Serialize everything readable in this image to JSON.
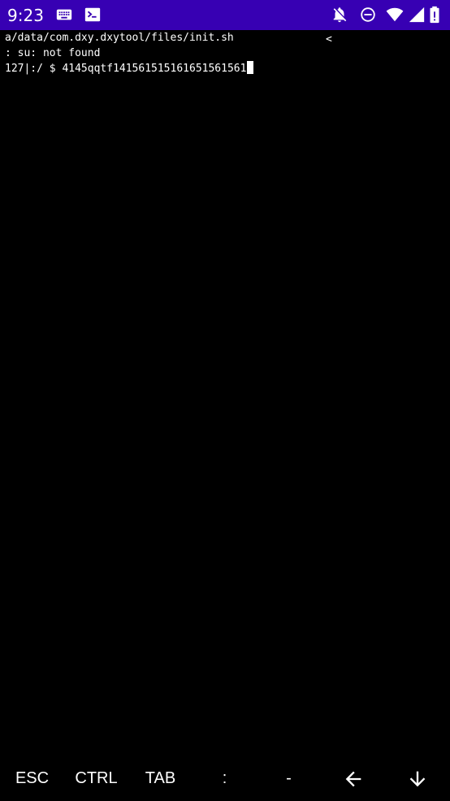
{
  "status_bar": {
    "time": "9:23",
    "background": "#3700b3",
    "left_icons": [
      "keyboard-icon",
      "terminal-icon"
    ],
    "right_icons": [
      "notifications-off-icon",
      "do-not-disturb-icon",
      "wifi-icon",
      "signal-icon",
      "battery-icon"
    ]
  },
  "terminal": {
    "background": "#000000",
    "foreground": "#ffffff",
    "lines": [
      "a/data/com.dxy.dxytool/files/init.sh",
      ": su: not found",
      "127|:/ $ 4145qqtf1415615151616515615 61"
    ],
    "prompt": "127|:/ $ ",
    "input": "4145qqtf141561515161651561561",
    "marker": "<"
  },
  "extra_keys": {
    "keys": [
      {
        "label": "ESC",
        "name": "esc-key"
      },
      {
        "label": "CTRL",
        "name": "ctrl-key"
      },
      {
        "label": "TAB",
        "name": "tab-key"
      },
      {
        "label": ":",
        "name": "colon-key"
      },
      {
        "label": "-",
        "name": "dash-key"
      }
    ],
    "arrow_icons": [
      "arrow-left-icon",
      "arrow-down-icon"
    ]
  }
}
